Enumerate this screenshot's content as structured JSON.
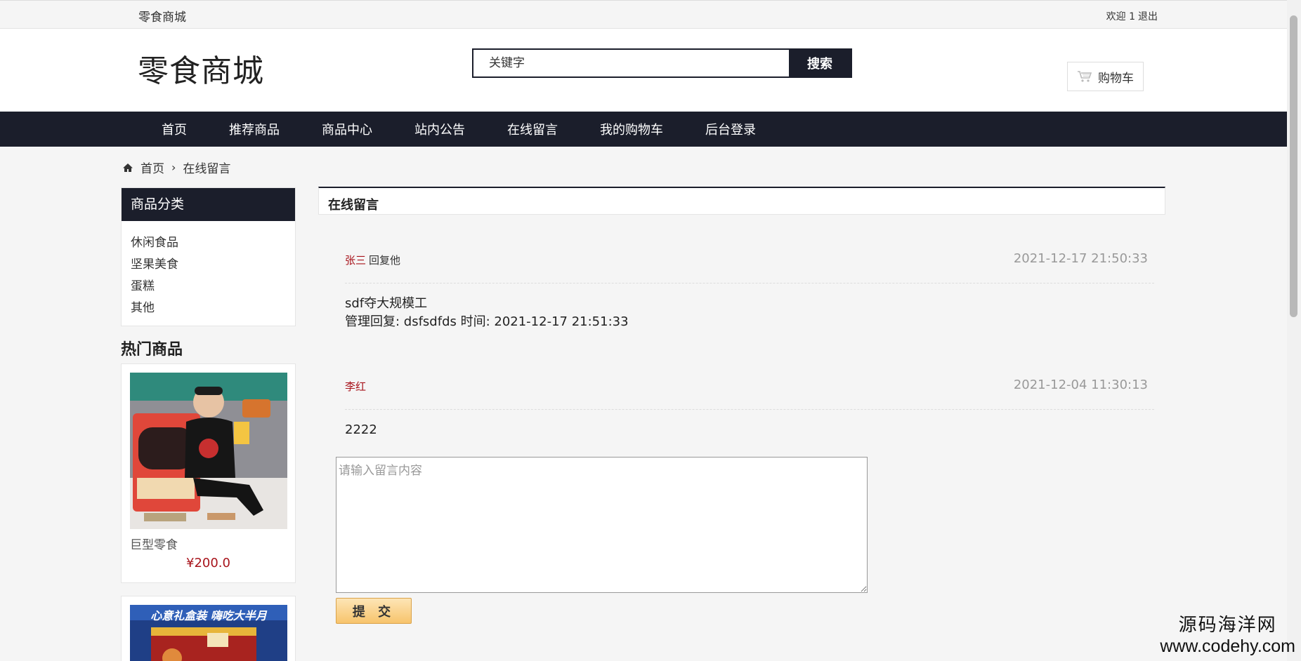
{
  "topbar": {
    "site_name": "零食商城",
    "welcome": "欢迎 1",
    "logout": "退出"
  },
  "header": {
    "logo": "零食商城",
    "search_placeholder": "关键字",
    "search_button": "搜索",
    "cart_label": "购物车"
  },
  "nav": {
    "items": [
      "首页",
      "推荐商品",
      "商品中心",
      "站内公告",
      "在线留言",
      "我的购物车",
      "后台登录"
    ]
  },
  "breadcrumb": {
    "home": "首页",
    "current": "在线留言"
  },
  "sidebar": {
    "category_title": "商品分类",
    "categories": [
      "休闲食品",
      "坚果美食",
      "蛋糕",
      "其他"
    ],
    "hot_title": "热门商品",
    "products": [
      {
        "name": "巨型零食",
        "price": "¥200.0"
      },
      {
        "banner_text": "心意礼盒装 嗨吃大半月"
      }
    ]
  },
  "main": {
    "title": "在线留言",
    "messages": [
      {
        "author": "张三",
        "reply_label": "回复他",
        "time": "2021-12-17 21:50:33",
        "content": "sdf夺大规模工",
        "admin_reply": "管理回复:   dsfsdfds 时间:  2021-12-17 21:51:33"
      },
      {
        "author": "李红",
        "time": "2021-12-04 11:30:13",
        "content": "2222"
      }
    ],
    "textarea_placeholder": "请输入留言内容",
    "submit_label": "提 交"
  },
  "watermark": {
    "cn": "源码海洋网",
    "en": "www.codehy.com"
  }
}
